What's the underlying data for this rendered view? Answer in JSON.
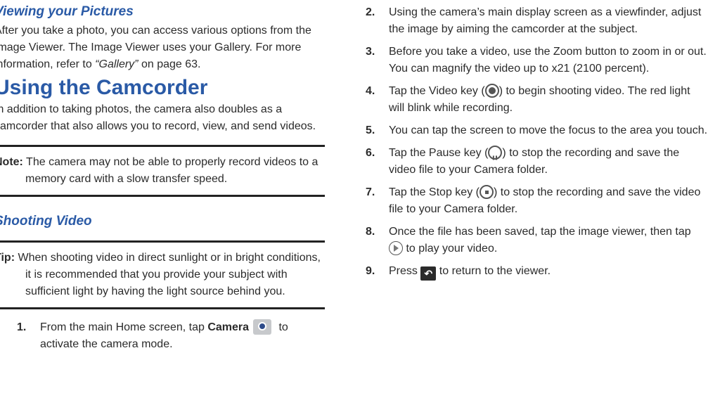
{
  "left": {
    "section1_title": "Viewing your Pictures",
    "section1_body_a": "After you take a photo, you can access various options from the Image Viewer. The Image Viewer uses your Gallery. For more information, refer to ",
    "section1_link": "“Gallery”",
    "section1_body_b": "  on page 63.",
    "section2_title": "Using the Camcorder",
    "section2_body": "In addition to taking photos, the camera also doubles as a camcorder that also allows you to record, view, and send videos.",
    "note_label": "Note:",
    "note_text": " The camera may not be able to properly record videos to a memory card with a slow transfer speed.",
    "section3_title": "Shooting Video",
    "tip_label": "Tip:",
    "tip_text": " When shooting video in direct sunlight or in bright conditions, it is recommended that you provide your subject with sufficient light by having the light source behind you.",
    "step1_num": "1.",
    "step1_a": "From the main Home screen, tap ",
    "step1_bold": "Camera",
    "step1_b": " to activate the camera mode."
  },
  "right": {
    "steps": [
      {
        "num": "2.",
        "text": "Using the camera’s main display screen as a viewfinder, adjust the image by aiming the camcorder at the subject."
      },
      {
        "num": "3.",
        "text": "Before you take a video, use the Zoom button to zoom in or out. You can magnify the video up to x21 (2100 percent)."
      },
      {
        "num": "4.",
        "a": "Tap the Video key (",
        "b": ") to begin shooting video. The red light will blink while recording."
      },
      {
        "num": "5.",
        "text": "You can tap the screen to move the focus to the area you touch."
      },
      {
        "num": "6.",
        "a": "Tap the Pause key (",
        "b": ") to stop the recording and save the video file to your Camera folder."
      },
      {
        "num": "7.",
        "a": "Tap the Stop key (",
        "b": ") to stop the recording and save the video file to your Camera folder."
      },
      {
        "num": "8.",
        "a": "Once the file has been saved, tap the image viewer, then tap ",
        "b": " to play your video."
      },
      {
        "num": "9.",
        "a": "Press ",
        "b": " to return to the viewer."
      }
    ]
  },
  "icons": [
    "camera-icon",
    "video-key-icon",
    "pause-key-icon",
    "stop-key-icon",
    "play-icon",
    "back-icon"
  ]
}
